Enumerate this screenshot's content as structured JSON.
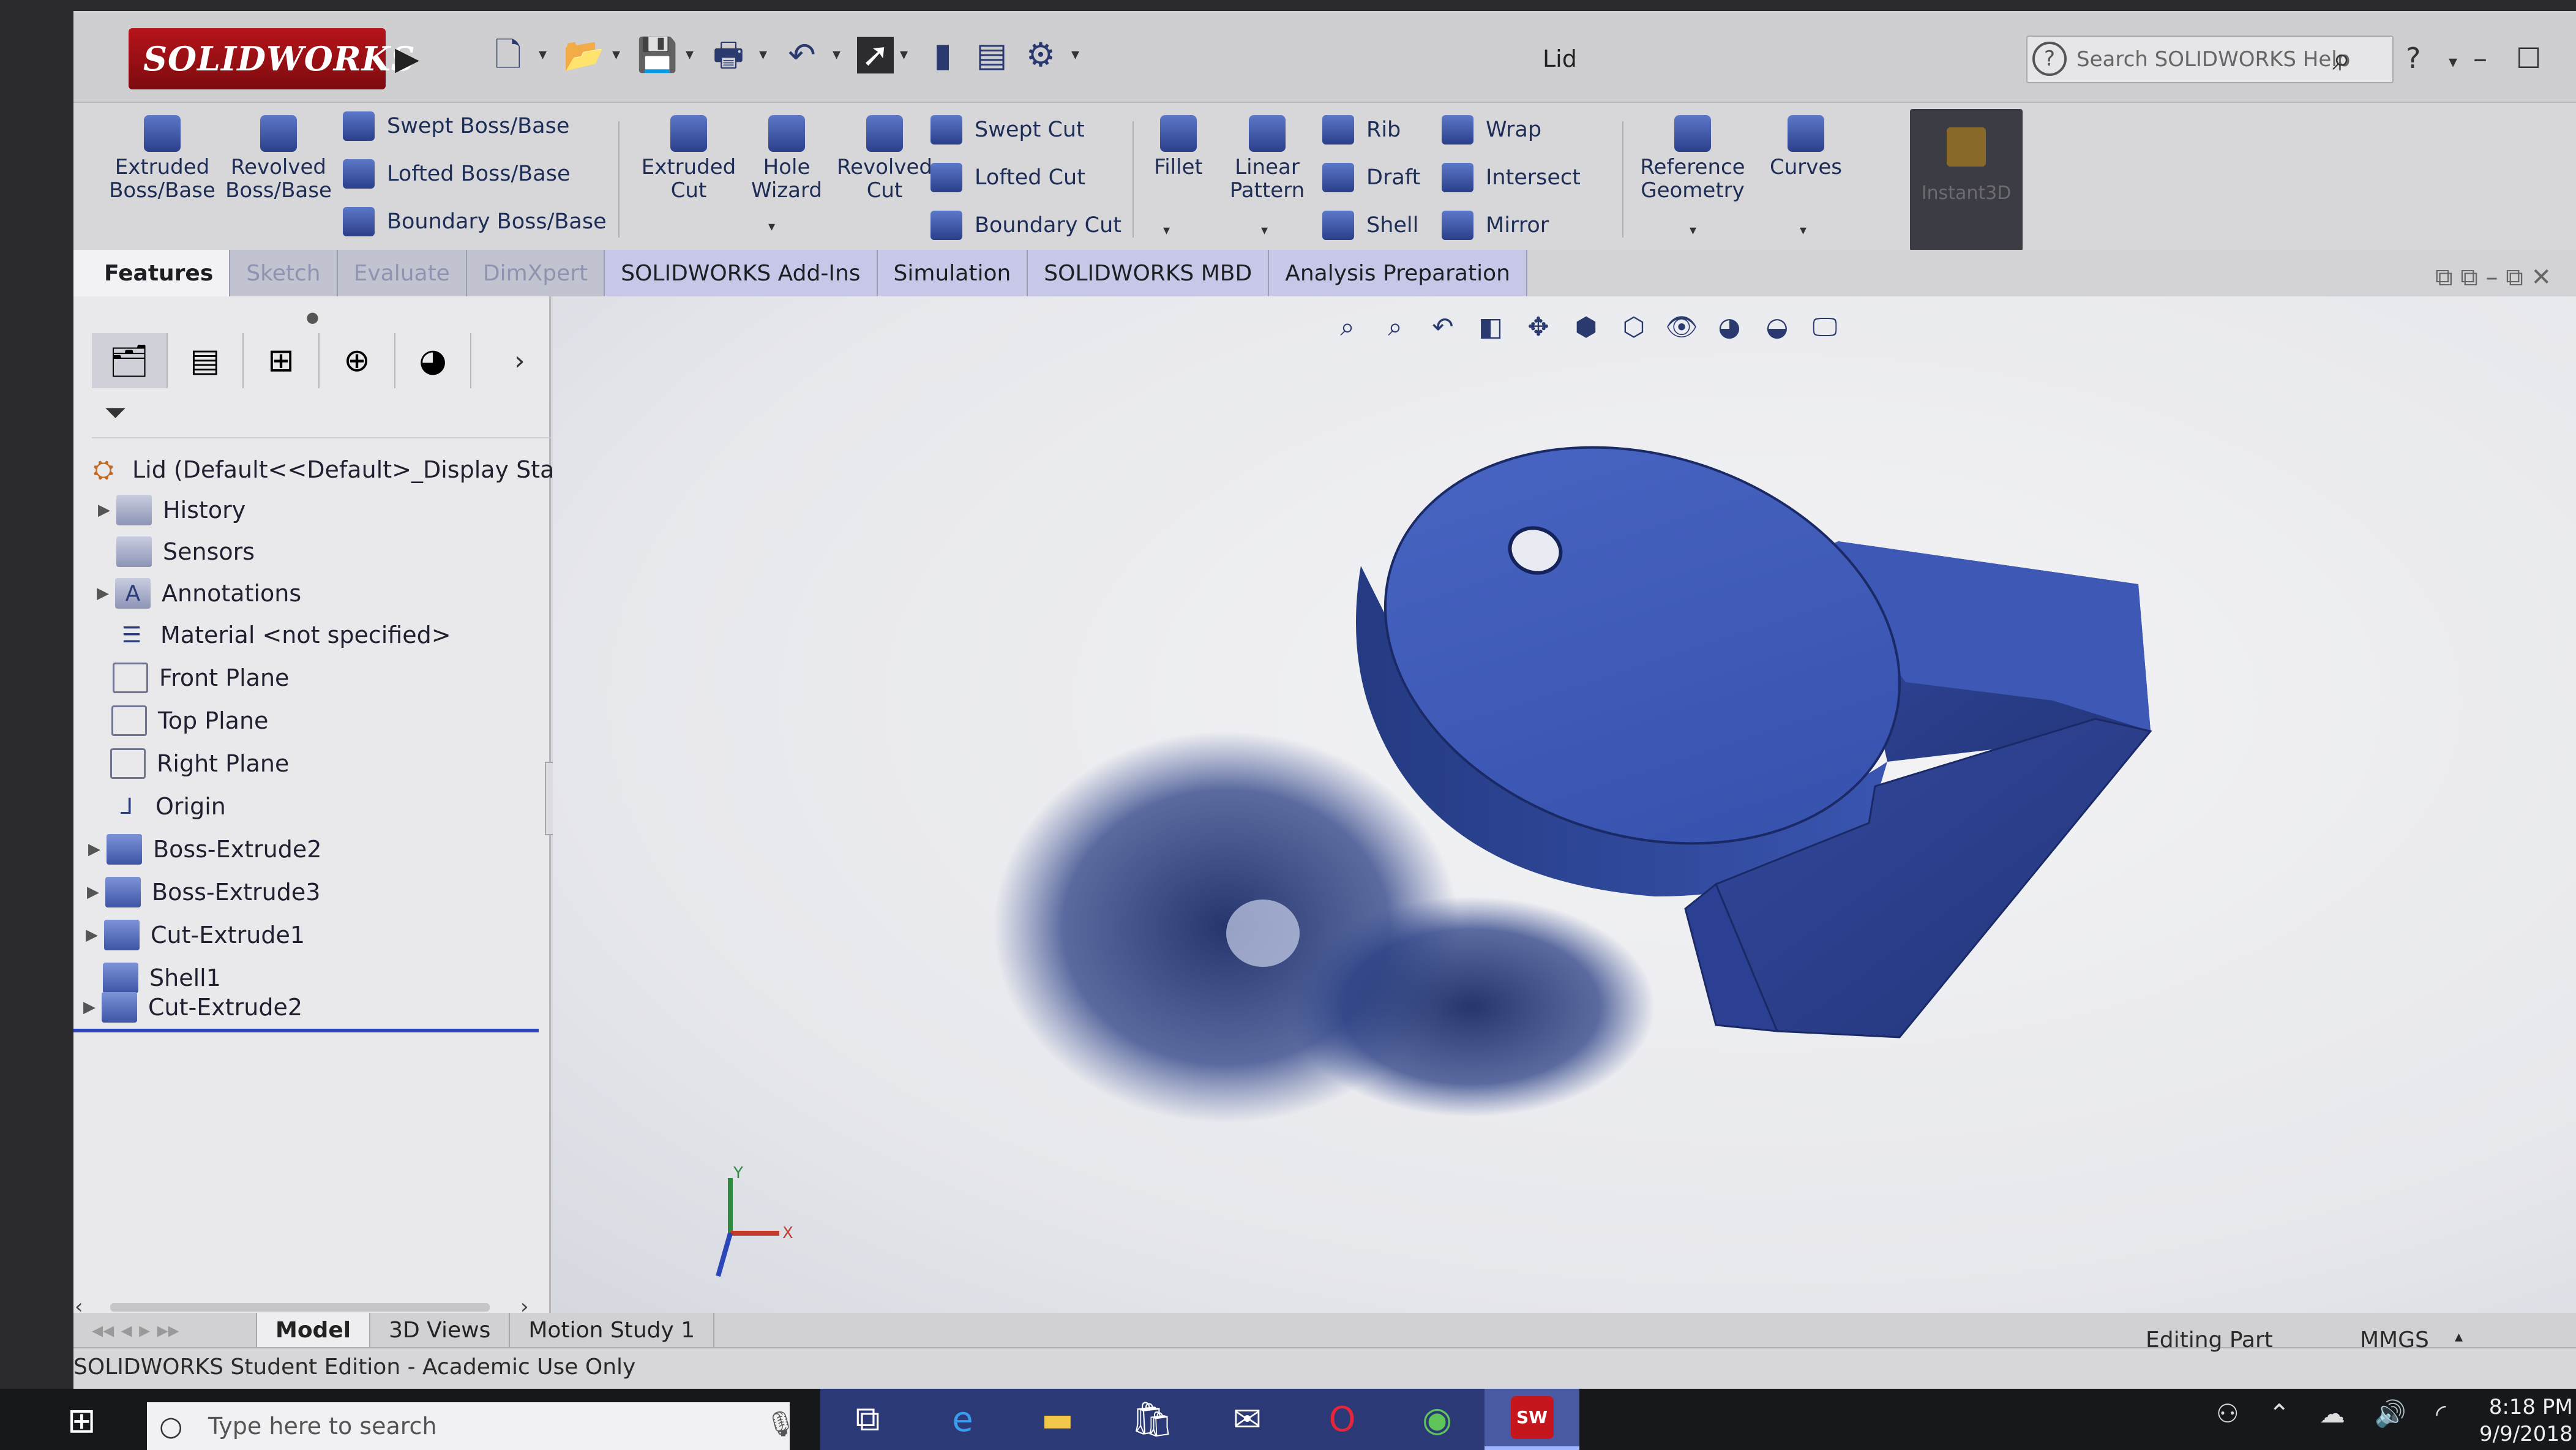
{
  "app": {
    "logo_text": "SOLIDWORKS",
    "document_title": "Lid",
    "search_placeholder": "Search SOLIDWORKS Help",
    "help_glyph": "?"
  },
  "command_manager": {
    "extruded_boss": "Extruded Boss/Base",
    "revolved_boss": "Revolved Boss/Base",
    "swept_boss": "Swept Boss/Base",
    "lofted_boss": "Lofted Boss/Base",
    "boundary_boss": "Boundary Boss/Base",
    "extruded_cut": "Extruded Cut",
    "hole_wizard": "Hole Wizard",
    "revolved_cut": "Revolved Cut",
    "swept_cut": "Swept Cut",
    "lofted_cut": "Lofted Cut",
    "boundary_cut": "Boundary Cut",
    "fillet": "Fillet",
    "linear_pattern": "Linear Pattern",
    "rib": "Rib",
    "draft": "Draft",
    "shell": "Shell",
    "wrap": "Wrap",
    "intersect": "Intersect",
    "mirror": "Mirror",
    "reference_geometry": "Reference Geometry",
    "curves": "Curves",
    "instant3d": "Instant3D"
  },
  "tabs": [
    "Features",
    "Sketch",
    "Evaluate",
    "DimXpert",
    "SOLIDWORKS Add-Ins",
    "Simulation",
    "SOLIDWORKS MBD",
    "Analysis Preparation"
  ],
  "feature_tree": {
    "root": "Lid  (Default<<Default>_Display Stat",
    "items": [
      {
        "label": "History",
        "icon": "history-folder-icon"
      },
      {
        "label": "Sensors",
        "icon": "sensors-folder-icon"
      },
      {
        "label": "Annotations",
        "icon": "annotations-icon"
      },
      {
        "label": "Material <not specified>",
        "icon": "material-icon"
      },
      {
        "label": "Front Plane",
        "icon": "plane-icon"
      },
      {
        "label": "Top Plane",
        "icon": "plane-icon"
      },
      {
        "label": "Right Plane",
        "icon": "plane-icon"
      },
      {
        "label": "Origin",
        "icon": "origin-icon"
      },
      {
        "label": "Boss-Extrude2",
        "icon": "boss-extrude-icon"
      },
      {
        "label": "Boss-Extrude3",
        "icon": "boss-extrude-icon"
      },
      {
        "label": "Cut-Extrude1",
        "icon": "cut-extrude-icon"
      },
      {
        "label": "Shell1",
        "icon": "shell-icon"
      },
      {
        "label": "Cut-Extrude2",
        "icon": "cut-extrude-icon"
      }
    ]
  },
  "bottom_tabs": [
    "Model",
    "3D Views",
    "Motion Study 1"
  ],
  "status": {
    "left": "SOLIDWORKS Student Edition - Academic Use Only",
    "editing": "Editing Part",
    "units": "MMGS"
  },
  "triad": {
    "x": "X",
    "y": "Y"
  },
  "taskbar": {
    "search_placeholder": "Type here to search",
    "time": "8:18 PM",
    "date": "9/9/2018"
  },
  "colors": {
    "model_blue": "#3c57b3",
    "model_dark": "#213678",
    "accent_red": "#b6141a",
    "taskbar_active": "#2b3a76"
  }
}
